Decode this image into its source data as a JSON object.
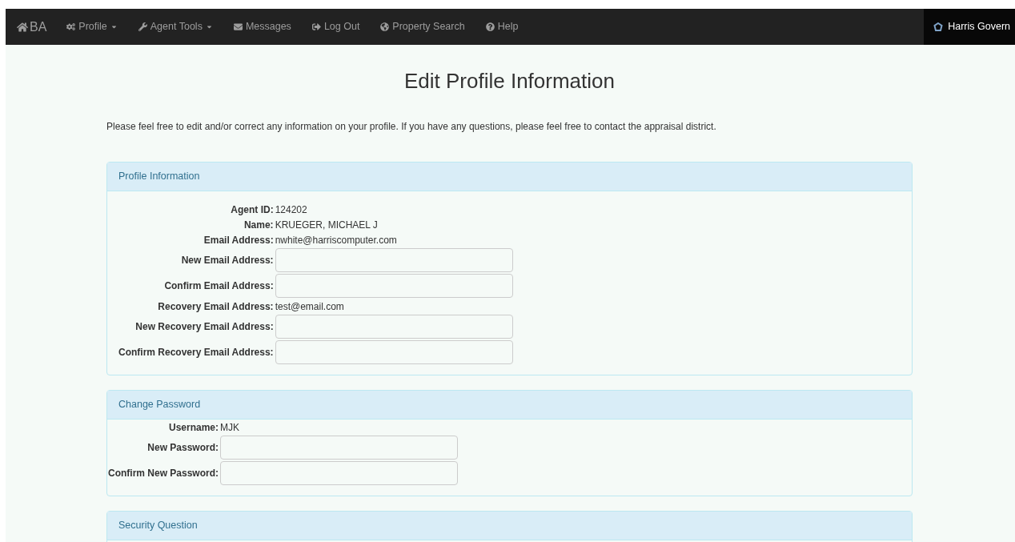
{
  "navbar": {
    "brand": "BA",
    "items": [
      {
        "label": "Profile",
        "dropdown": true
      },
      {
        "label": "Agent Tools",
        "dropdown": true
      },
      {
        "label": "Messages",
        "dropdown": false
      },
      {
        "label": "Log Out",
        "dropdown": false
      },
      {
        "label": "Property Search",
        "dropdown": false
      },
      {
        "label": "Help",
        "dropdown": false
      }
    ],
    "right_label": "Harris Govern"
  },
  "page_title": "Edit Profile Information",
  "intro": "Please feel free to edit and/or correct any information on your profile. If you have any questions, please feel free to contact the appraisal district.",
  "panels": [
    {
      "title": "Profile Information",
      "rows": [
        {
          "kind": "text",
          "label": "Agent ID:",
          "value": "124202"
        },
        {
          "kind": "text",
          "label": "Name:",
          "value": "KRUEGER, MICHAEL J"
        },
        {
          "kind": "text",
          "label": "Email Address:",
          "value": "nwhite@harriscomputer.com"
        },
        {
          "kind": "input",
          "label": "New Email Address:"
        },
        {
          "kind": "input",
          "label": "Confirm Email Address:"
        },
        {
          "kind": "text",
          "label": "Recovery Email Address:",
          "value": "test@email.com"
        },
        {
          "kind": "input",
          "label": "New Recovery Email Address:"
        },
        {
          "kind": "input",
          "label": "Confirm Recovery Email Address:"
        }
      ]
    },
    {
      "title": "Change Password",
      "rows": [
        {
          "kind": "text",
          "label": "Username:",
          "value": "MJK"
        },
        {
          "kind": "input",
          "label": "New Password:"
        },
        {
          "kind": "input",
          "label": "Confirm New Password:"
        }
      ]
    },
    {
      "title": "Security Question"
    }
  ]
}
